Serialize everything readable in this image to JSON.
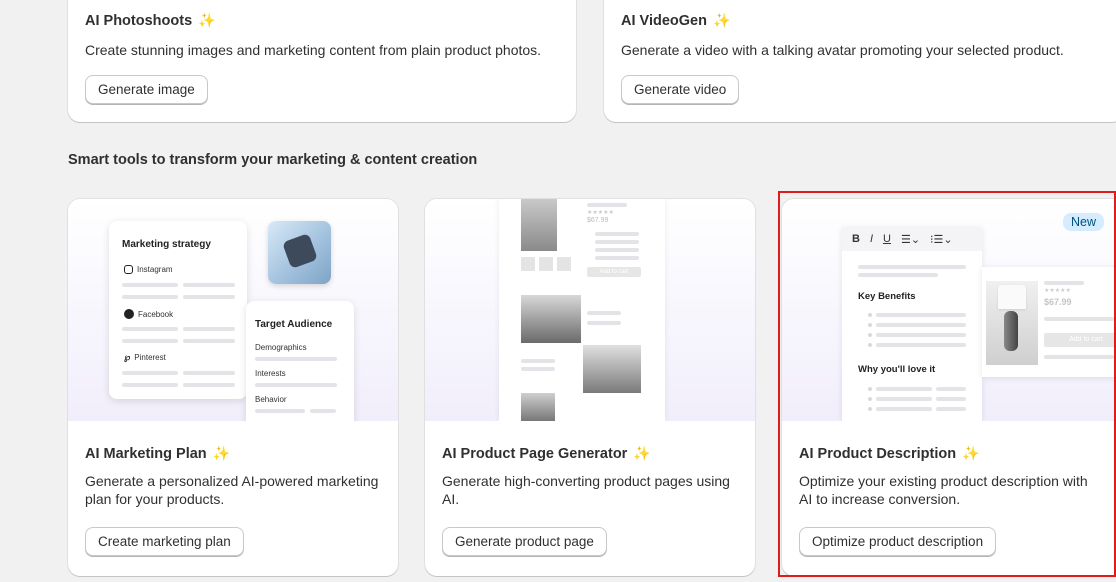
{
  "top_cards": [
    {
      "title": "AI Photoshoots",
      "description": "Create stunning images and marketing content from plain product photos.",
      "button": "Generate image"
    },
    {
      "title": "AI VideoGen",
      "description": "Generate a video with a talking avatar promoting your selected product.",
      "button": "Generate video"
    }
  ],
  "section": {
    "heading": "Smart tools to transform your marketing & content creation"
  },
  "tool_cards": [
    {
      "title": "AI Marketing Plan",
      "description": "Generate a personalized AI-powered marketing plan for your products.",
      "button": "Create marketing plan",
      "illustration": {
        "strategy_title": "Marketing strategy",
        "channels": [
          "Instagram",
          "Facebook",
          "Pinterest"
        ],
        "audience_title": "Target Audience",
        "audience_items": [
          "Demographics",
          "Interests",
          "Behavior"
        ]
      }
    },
    {
      "title": "AI Product Page Generator",
      "description": "Generate high-converting product pages using AI.",
      "button": "Generate product page",
      "illustration": {
        "price": "$67.99",
        "cart": "Add to cart"
      }
    },
    {
      "title": "AI Product Description",
      "description": "Optimize your existing product description with AI to increase conversion.",
      "button": "Optimize product description",
      "badge": "New",
      "illustration": {
        "toolbar": [
          "B",
          "I",
          "U"
        ],
        "heading1": "Key Benefits",
        "heading2": "Why you'll love it",
        "price": "$67.99",
        "cart": "Add to cart"
      }
    }
  ],
  "sparkle_icon": "sparkle-icon",
  "highlight_color": "#e01b1b"
}
